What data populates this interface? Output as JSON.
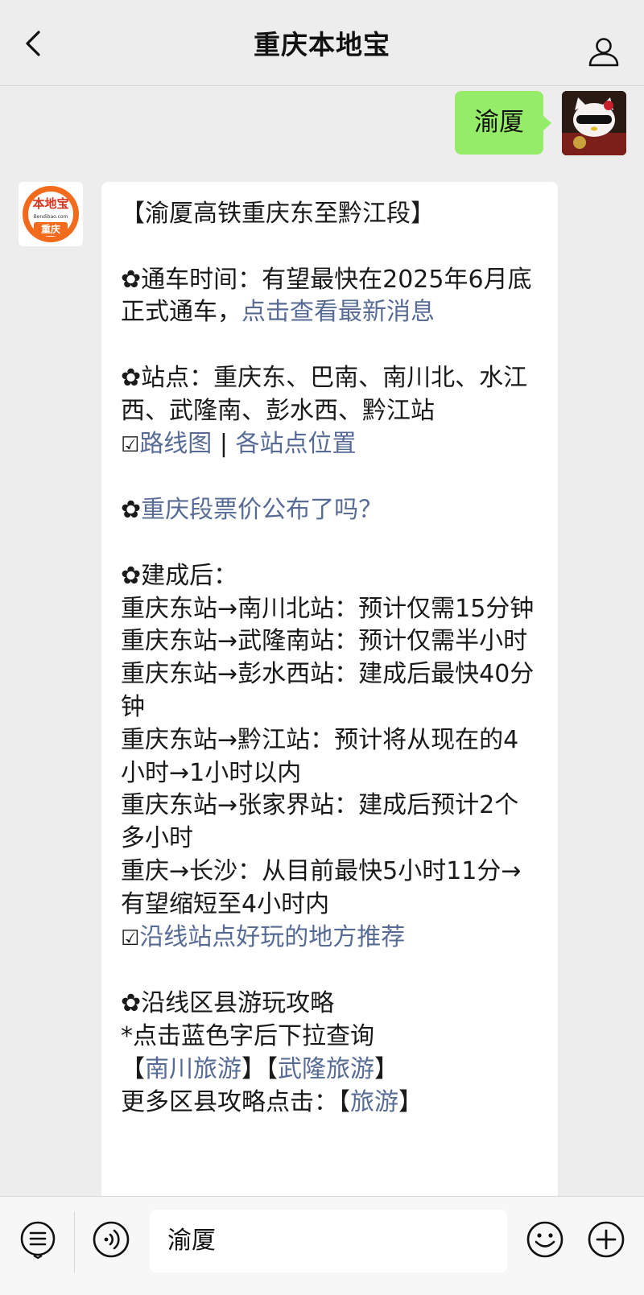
{
  "header": {
    "title": "重庆本地宝"
  },
  "outgoing": {
    "text": "渝厦"
  },
  "brand_avatar": {
    "line1": "本地宝",
    "line2": "Bendibao.com",
    "line3": "重庆"
  },
  "message": {
    "title": "【渝厦高铁重庆东至黔江段】",
    "opening": {
      "prefix": "✿通车时间：有望最快在2025年6月底正式通车，",
      "link": "点击查看最新消息"
    },
    "stations": {
      "text": "✿站点：重庆东、巴南、南川北、水江西、武隆南、彭水西、黔江站",
      "check_icon": "☑",
      "link1": "路线图",
      "separator": " | ",
      "link2": "各站点位置"
    },
    "price": {
      "flower": "✿",
      "link": "重庆段票价公布了吗？"
    },
    "after": {
      "heading": "✿建成后：",
      "lines": [
        "重庆东站→南川北站：预计仅需15分钟",
        "重庆东站→武隆南站：预计仅需半小时",
        "重庆东站→彭水西站：建成后最快40分钟",
        "重庆东站→黔江站：预计将从现在的4小时→1小时以内",
        "重庆东站→张家界站：建成后预计2个多小时",
        "重庆→长沙：从目前最快5小时11分→有望缩短至4小时内"
      ],
      "check_icon": "☑",
      "link": "沿线站点好玩的地方推荐"
    },
    "tours": {
      "heading": "✿沿线区县游玩攻略",
      "hint": "*点击蓝色字后下拉查询",
      "bracket_open": "【",
      "link_nanchuan": "南川旅游",
      "bracket_mid": "】【",
      "link_wulong": "武隆旅游",
      "bracket_close": "】",
      "more_prefix": "更多区县攻略点击：【",
      "more_link": "旅游",
      "more_suffix": "】"
    }
  },
  "input": {
    "value": "渝厦"
  },
  "icons": {
    "back": "back-arrow-icon",
    "profile": "person-icon",
    "menu": "list-menu-icon",
    "voice": "voice-icon",
    "emoji": "smiley-icon",
    "add": "plus-icon"
  },
  "colors": {
    "link": "#576b95",
    "outgoing_bubble": "#95ec69",
    "brand_orange": "#f26b1d"
  }
}
